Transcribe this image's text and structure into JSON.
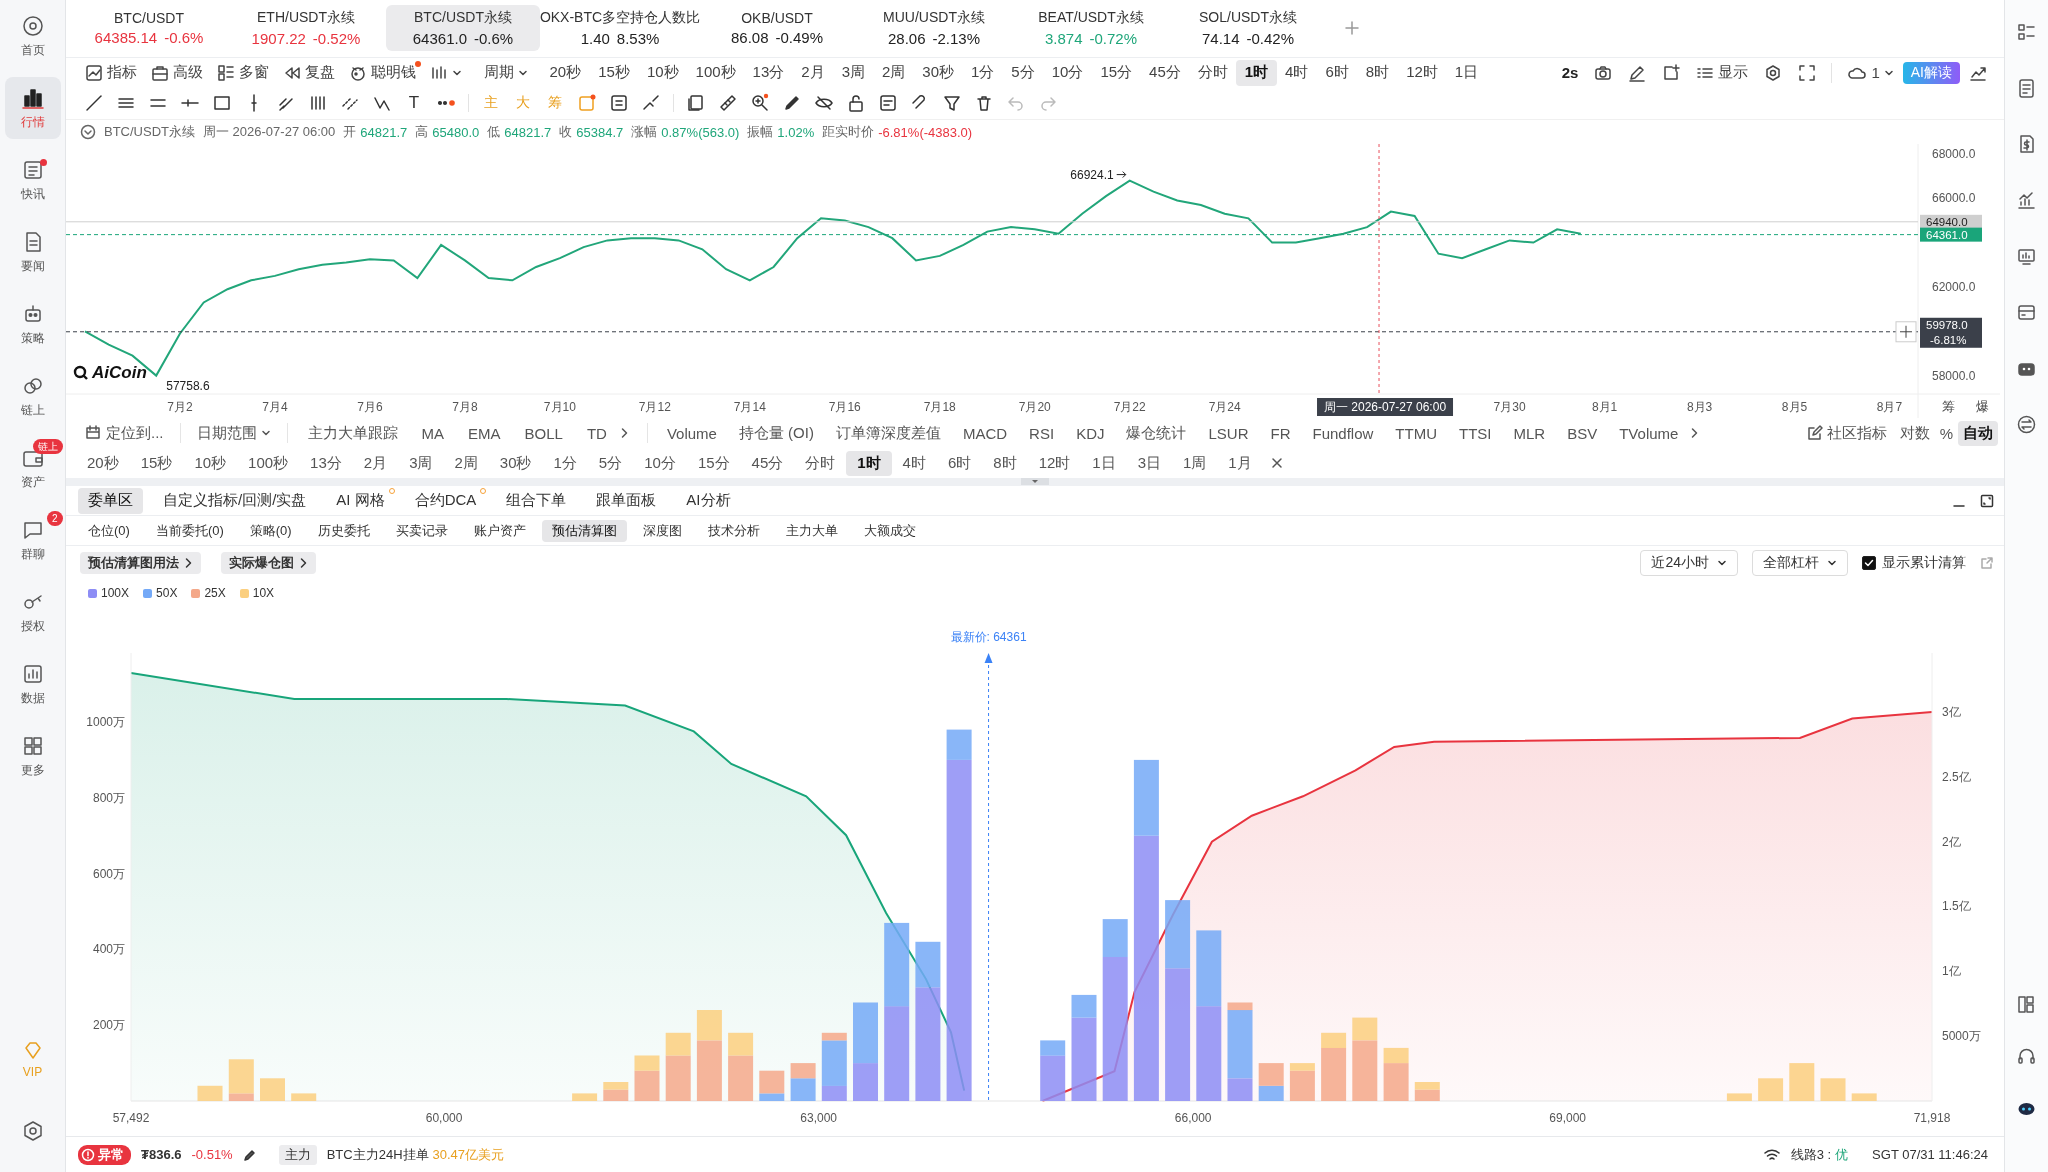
{
  "sidebar": {
    "items": [
      {
        "label": "首页",
        "selected": false,
        "unread": false
      },
      {
        "label": "行情",
        "selected": true,
        "unread": false
      },
      {
        "label": "快讯",
        "selected": false,
        "unread": true
      },
      {
        "label": "要闻",
        "selected": false,
        "unread": false
      },
      {
        "label": "策略",
        "selected": false,
        "unread": false
      },
      {
        "label": "链上",
        "selected": false,
        "unread": false
      },
      {
        "label": "资产",
        "selected": false,
        "unread": false,
        "badge": "链上"
      },
      {
        "label": "群聊",
        "selected": false,
        "unread": false,
        "badge": "2"
      },
      {
        "label": "授权",
        "selected": false,
        "unread": false
      },
      {
        "label": "数据",
        "selected": false,
        "unread": false
      },
      {
        "label": "更多",
        "selected": false,
        "unread": false
      }
    ],
    "vip": "VIP"
  },
  "tickers": [
    {
      "symbol": "BTC/USDT",
      "price": "64385.14",
      "change": "-0.6%",
      "color": "#e8343f",
      "selected": false
    },
    {
      "symbol": "ETH/USDT永续",
      "price": "1907.22",
      "change": "-0.52%",
      "color": "#e8343f",
      "selected": false
    },
    {
      "symbol": "BTC/USDT永续",
      "price": "64361.0",
      "change": "-0.6%",
      "color": "#222222",
      "selected": true
    },
    {
      "symbol": "OKX-BTC多空持仓人数比",
      "price": "1.40",
      "change": "8.53%",
      "color": "#222222",
      "selected": false
    },
    {
      "symbol": "OKB/USDT",
      "price": "86.08",
      "change": "-0.49%",
      "color": "#222222",
      "selected": false
    },
    {
      "symbol": "MUU/USDT永续",
      "price": "28.06",
      "change": "-2.13%",
      "color": "#222222",
      "selected": false
    },
    {
      "symbol": "BEAT/USDT永续",
      "price": "3.874",
      "change": "-0.72%",
      "color": "#1fa67a",
      "selected": false
    },
    {
      "symbol": "SOL/USDT永续",
      "price": "74.14",
      "change": "-0.42%",
      "color": "#222222",
      "selected": false
    }
  ],
  "toolbar": {
    "tools": [
      {
        "label": "指标",
        "dot": false
      },
      {
        "label": "高级",
        "dot": false
      },
      {
        "label": "多窗",
        "dot": false
      },
      {
        "label": "复盘",
        "dot": false
      },
      {
        "label": "聪明钱",
        "dot": true
      }
    ],
    "period_menu": "周期",
    "periods": [
      {
        "label": "20秒",
        "selected": false
      },
      {
        "label": "15秒",
        "selected": false
      },
      {
        "label": "10秒",
        "selected": false
      },
      {
        "label": "100秒",
        "selected": false
      },
      {
        "label": "13分",
        "selected": false
      },
      {
        "label": "2月",
        "selected": false
      },
      {
        "label": "3周",
        "selected": false
      },
      {
        "label": "2周",
        "selected": false
      },
      {
        "label": "30秒",
        "selected": false
      },
      {
        "label": "1分",
        "selected": false
      },
      {
        "label": "5分",
        "selected": false
      },
      {
        "label": "10分",
        "selected": false
      },
      {
        "label": "15分",
        "selected": false
      },
      {
        "label": "45分",
        "selected": false
      },
      {
        "label": "分时",
        "selected": false
      },
      {
        "label": "1时",
        "selected": true
      },
      {
        "label": "4时",
        "selected": false
      },
      {
        "label": "6时",
        "selected": false
      },
      {
        "label": "8时",
        "selected": false
      },
      {
        "label": "12时",
        "selected": false
      },
      {
        "label": "1日",
        "selected": false
      }
    ],
    "refresh": "2s",
    "display": "显示",
    "layout_count": "1",
    "ai_button": "AI解读"
  },
  "drawing_tools": {
    "text_tool": "T",
    "shortcuts": [
      "主",
      "大",
      "筹"
    ]
  },
  "chart": {
    "header": {
      "symbol": "BTC/USDT永续",
      "time": "周一 2026-07-27 06:00",
      "fields": [
        {
          "label": "开",
          "value": "64821.7",
          "color": "#1fa67a"
        },
        {
          "label": "高",
          "value": "65480.0",
          "color": "#1fa67a"
        },
        {
          "label": "低",
          "value": "64821.7",
          "color": "#1fa67a"
        },
        {
          "label": "收",
          "value": "65384.7",
          "color": "#1fa67a"
        },
        {
          "label": "涨幅",
          "value": "0.87%(563.0)",
          "color": "#1fa67a"
        },
        {
          "label": "振幅",
          "value": "1.02%",
          "color": "#1fa67a"
        },
        {
          "label": "距实时价",
          "value": "-6.81%(-4383.0)",
          "color": "#e8343f"
        }
      ]
    },
    "logo": "AiCoin",
    "axis_buttons": [
      "筹",
      "爆"
    ],
    "crosshair_change": "-6.81%",
    "crosshair_time": "周一 2026-07-27 06:00",
    "chart_data": {
      "type": "line",
      "categories": [
        null,
        null,
        null,
        null,
        "7月2",
        null,
        null,
        null,
        "7月4",
        null,
        null,
        null,
        "7月6",
        null,
        null,
        null,
        "7月8",
        null,
        null,
        null,
        "7月10",
        null,
        null,
        null,
        "7月12",
        null,
        null,
        null,
        "7月14",
        null,
        null,
        null,
        "7月16",
        null,
        null,
        null,
        "7月18",
        null,
        null,
        null,
        "7月20",
        null,
        null,
        null,
        "7月22",
        null,
        null,
        null,
        "7月24",
        null,
        null,
        null,
        null,
        null,
        null,
        null,
        null,
        null,
        null,
        null,
        "7月30",
        null,
        null,
        null,
        "8月1",
        null,
        null,
        null,
        "8月3",
        null,
        null,
        null,
        "8月5",
        null,
        null,
        null,
        "8月7"
      ],
      "series": [
        {
          "color": "#22a67a",
          "values": [
            60000,
            59400,
            58900,
            58000,
            59900,
            61300,
            61900,
            62300,
            62500,
            62800,
            63000,
            63100,
            63250,
            63200,
            62400,
            63900,
            63200,
            62400,
            62300,
            62900,
            63300,
            63800,
            64100,
            64200,
            64200,
            64100,
            63700,
            62800,
            62300,
            62900,
            64200,
            65100,
            65000,
            64700,
            64200,
            63200,
            63400,
            63900,
            64500,
            64700,
            64600,
            64400,
            65300,
            66100,
            66800,
            66300,
            65900,
            65700,
            65300,
            65100,
            64000,
            64000,
            64200,
            64400,
            64700,
            65400,
            65200,
            63500,
            63300,
            63700,
            64100,
            64000,
            64600,
            64400,
            null,
            null,
            null,
            null,
            null,
            null,
            null,
            null,
            null,
            null,
            null,
            null,
            null
          ]
        }
      ],
      "ylim": [
        57170,
        68451
      ],
      "yticks": [
        {
          "value": 58000,
          "label": "58000.0"
        },
        {
          "value": 62000,
          "label": "62000.0"
        },
        {
          "value": 66000,
          "label": "66000.0"
        },
        {
          "value": 68000,
          "label": "68000.0"
        }
      ],
      "annotations": [
        "66924.1",
        "57758.6"
      ],
      "ref_lines": [
        {
          "axis": "y",
          "value": 64940,
          "label": "64940.0",
          "color": "#cfcfcf"
        },
        {
          "axis": "y",
          "value": 64361,
          "label": "64361.0",
          "color": "#1aa57a"
        },
        {
          "axis": "y",
          "value": 59978,
          "label": "59978.0",
          "color": "#3b404a"
        }
      ]
    }
  },
  "indicator_bar": {
    "locate": "定位到...",
    "date_range": "日期范围",
    "main_indicators": [
      "主力大单跟踪",
      "MA",
      "EMA",
      "BOLL",
      "TD"
    ],
    "sub_indicators": [
      "Volume",
      "持仓量 (OI)",
      "订单簿深度差值",
      "MACD",
      "RSI",
      "KDJ",
      "爆仓统计",
      "LSUR",
      "FR",
      "Fundflow",
      "TTMU",
      "TTSI",
      "MLR",
      "BSV",
      "TVolume"
    ],
    "community": "社区指标",
    "scale_options": [
      {
        "label": "对数",
        "selected": false
      },
      {
        "label": "%",
        "selected": false
      },
      {
        "label": "自动",
        "selected": true
      }
    ],
    "periods": [
      {
        "label": "20秒",
        "selected": false
      },
      {
        "label": "15秒",
        "selected": false
      },
      {
        "label": "10秒",
        "selected": false
      },
      {
        "label": "100秒",
        "selected": false
      },
      {
        "label": "13分",
        "selected": false
      },
      {
        "label": "2月",
        "selected": false
      },
      {
        "label": "3周",
        "selected": false
      },
      {
        "label": "2周",
        "selected": false
      },
      {
        "label": "30秒",
        "selected": false
      },
      {
        "label": "1分",
        "selected": false
      },
      {
        "label": "5分",
        "selected": false
      },
      {
        "label": "10分",
        "selected": false
      },
      {
        "label": "15分",
        "selected": false
      },
      {
        "label": "45分",
        "selected": false
      },
      {
        "label": "分时",
        "selected": false
      },
      {
        "label": "1时",
        "selected": true
      },
      {
        "label": "4时",
        "selected": false
      },
      {
        "label": "6时",
        "selected": false
      },
      {
        "label": "8时",
        "selected": false
      },
      {
        "label": "12时",
        "selected": false
      },
      {
        "label": "1日",
        "selected": false
      },
      {
        "label": "3日",
        "selected": false
      },
      {
        "label": "1周",
        "selected": false
      },
      {
        "label": "1月",
        "selected": false
      }
    ]
  },
  "order_panel": {
    "tabs": [
      {
        "label": "委单区",
        "selected": true,
        "dot": false
      },
      {
        "label": "自定义指标/回测/实盘",
        "selected": false,
        "dot": false
      },
      {
        "label": "AI 网格",
        "selected": false,
        "dot": true
      },
      {
        "label": "合约DCA",
        "selected": false,
        "dot": true
      },
      {
        "label": "组合下单",
        "selected": false,
        "dot": false
      },
      {
        "label": "跟单面板",
        "selected": false,
        "dot": false
      },
      {
        "label": "AI分析",
        "selected": false,
        "dot": false
      }
    ],
    "subtabs": [
      {
        "label": "仓位(0)",
        "selected": false
      },
      {
        "label": "当前委托(0)",
        "selected": false
      },
      {
        "label": "策略(0)",
        "selected": false
      },
      {
        "label": "历史委托",
        "selected": false
      },
      {
        "label": "买卖记录",
        "selected": false
      },
      {
        "label": "账户资产",
        "selected": false
      },
      {
        "label": "预估清算图",
        "selected": true
      },
      {
        "label": "深度图",
        "selected": false
      },
      {
        "label": "技术分析",
        "selected": false
      },
      {
        "label": "主力大单",
        "selected": false
      },
      {
        "label": "大额成交",
        "selected": false
      }
    ],
    "guide_buttons": [
      "预估清算图用法",
      "实际爆仓图"
    ],
    "range_select": "近24小时",
    "leverage_select": "全部杠杆",
    "cumulative_toggle": {
      "label": "显示累计清算",
      "checked": true
    },
    "histogram": {
      "chart_data": {
        "type": "bar",
        "stacked": true,
        "x": [
          57625,
          57875,
          58125,
          58375,
          58625,
          58875,
          59125,
          59375,
          59625,
          59875,
          60125,
          60375,
          60625,
          60875,
          61125,
          61375,
          61625,
          61875,
          62125,
          62375,
          62625,
          62875,
          63125,
          63375,
          63625,
          63875,
          64125,
          64375,
          64625,
          64875,
          65125,
          65375,
          65625,
          65875,
          66125,
          66375,
          66625,
          66875,
          67125,
          67375,
          67625,
          67875,
          68125,
          68375,
          68625,
          68875,
          69125,
          69375,
          69625,
          69875,
          70125,
          70375,
          70625,
          70875,
          71125,
          71375,
          71625,
          71875
        ],
        "series": [
          {
            "name": "100X",
            "color": "#8d8df5",
            "values": [
              0,
              0,
              0,
              0,
              0,
              0,
              0,
              0,
              0,
              0,
              0,
              0,
              0,
              0,
              0,
              0,
              0,
              0,
              0,
              0,
              0,
              0,
              40,
              100,
              250,
              300,
              900,
              0,
              0,
              120,
              220,
              380,
              700,
              350,
              250,
              60,
              0,
              0,
              0,
              0,
              0,
              0,
              0,
              0,
              0,
              0,
              0,
              0,
              0,
              0,
              0,
              0,
              0,
              0,
              0,
              0,
              0,
              0
            ]
          },
          {
            "name": "50X",
            "color": "#74a9f7",
            "values": [
              0,
              0,
              0,
              0,
              0,
              0,
              0,
              0,
              0,
              0,
              0,
              0,
              0,
              0,
              0,
              0,
              0,
              0,
              0,
              0,
              20,
              60,
              120,
              160,
              220,
              120,
              80,
              0,
              0,
              40,
              60,
              100,
              200,
              180,
              200,
              180,
              40,
              0,
              0,
              0,
              0,
              0,
              0,
              0,
              0,
              0,
              0,
              0,
              0,
              0,
              0,
              0,
              0,
              0,
              0,
              0,
              0,
              0
            ]
          },
          {
            "name": "25X",
            "color": "#f4a889",
            "values": [
              0,
              0,
              0,
              20,
              0,
              0,
              0,
              0,
              0,
              0,
              0,
              0,
              0,
              0,
              0,
              30,
              80,
              120,
              160,
              120,
              60,
              40,
              20,
              0,
              0,
              0,
              0,
              0,
              0,
              0,
              0,
              0,
              0,
              0,
              0,
              20,
              60,
              80,
              140,
              160,
              100,
              30,
              0,
              0,
              0,
              0,
              0,
              0,
              0,
              0,
              0,
              0,
              0,
              0,
              0,
              0,
              0,
              0
            ]
          },
          {
            "name": "10X",
            "color": "#fbcf7f",
            "values": [
              0,
              0,
              40,
              90,
              60,
              20,
              0,
              0,
              0,
              0,
              0,
              0,
              0,
              0,
              20,
              20,
              40,
              60,
              80,
              60,
              0,
              0,
              0,
              0,
              0,
              0,
              0,
              0,
              0,
              0,
              0,
              0,
              0,
              0,
              0,
              0,
              0,
              20,
              40,
              60,
              40,
              20,
              0,
              0,
              0,
              0,
              0,
              0,
              0,
              0,
              0,
              20,
              60,
              100,
              60,
              20,
              0,
              0
            ]
          }
        ],
        "xlim": [
          57492,
          71918
        ],
        "ylim": [
          0,
          1182
        ],
        "xticks": [
          {
            "value": 57492,
            "label": "57,492"
          },
          {
            "value": 60000,
            "label": "60,000"
          },
          {
            "value": 63000,
            "label": "63,000"
          },
          {
            "value": 66000,
            "label": "66,000"
          },
          {
            "value": 69000,
            "label": "69,000"
          },
          {
            "value": 71918,
            "label": "71,918"
          }
        ],
        "yticks": [
          {
            "value": 200,
            "label": "200万"
          },
          {
            "value": 400,
            "label": "400万"
          },
          {
            "value": 600,
            "label": "600万"
          },
          {
            "value": 800,
            "label": "800万"
          },
          {
            "value": 1000,
            "label": "1000万"
          }
        ],
        "ref_lines": [
          {
            "axis": "x",
            "value": 64361,
            "label": "最新价: 64361",
            "color": "#3b82f6"
          }
        ]
      }
    },
    "cumulative": {
      "first_tick_label": "5000万",
      "chart_data": {
        "type": "area",
        "x": [
          57492,
          58800,
          60500,
          61450,
          62000,
          62300,
          62900,
          63220,
          63540,
          63860,
          64060,
          64166,
          64793,
          65370,
          65530,
          65840,
          66150,
          66470,
          66880,
          67300,
          67610,
          67930,
          70860,
          71280,
          71918
        ],
        "series": [
          {
            "color": "#18a57a",
            "values": [
              3.3,
              3.1,
              3.1,
              3.05,
              2.85,
              2.6,
              2.35,
              2.05,
              1.45,
              0.94,
              0.53,
              0.08,
              null,
              null,
              null,
              null,
              null,
              null,
              null,
              null,
              null,
              null,
              null,
              null,
              null
            ]
          },
          {
            "color": "#e8343f",
            "values": [
              null,
              null,
              null,
              null,
              null,
              null,
              null,
              null,
              null,
              null,
              null,
              null,
              0,
              0.23,
              0.84,
              1.44,
              2.0,
              2.2,
              2.35,
              2.55,
              2.73,
              2.77,
              2.8,
              2.95,
              3.0
            ]
          }
        ],
        "xlim": [
          57492,
          71918
        ],
        "ylim": [
          0,
          3.455
        ],
        "yticks": [
          {
            "value": 1,
            "label": "1亿"
          },
          {
            "value": 1.5,
            "label": "1.5亿"
          },
          {
            "value": 2,
            "label": "2亿"
          },
          {
            "value": 2.5,
            "label": "2.5亿"
          },
          {
            "value": 3,
            "label": "3亿"
          }
        ]
      }
    }
  },
  "status_bar": {
    "alert": "异常",
    "price": "₮836.6",
    "change": "-0.51%",
    "tag": "主力",
    "message": "BTC主力24H挂单",
    "amount": "30.47亿美元",
    "line": "线路3 :",
    "line_quality": "优",
    "clock": "SGT 07/31 11:46:24"
  }
}
